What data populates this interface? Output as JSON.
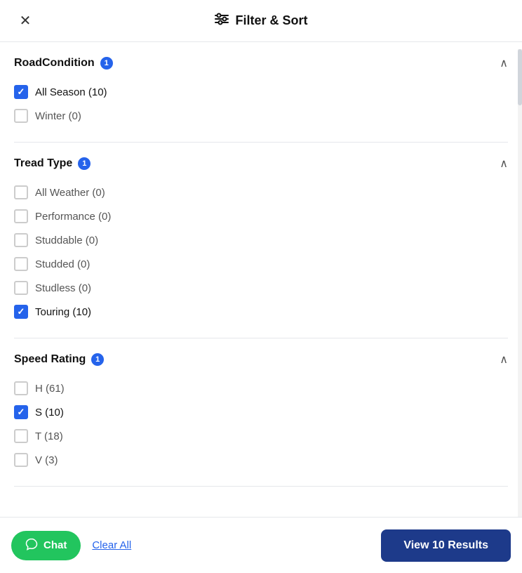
{
  "header": {
    "title": "Filter & Sort",
    "close_label": "×"
  },
  "sections": [
    {
      "id": "road-condition",
      "title": "RoadCondition",
      "info": "1",
      "expanded": true,
      "items": [
        {
          "id": "all-season",
          "label": "All Season",
          "count": 10,
          "checked": true
        },
        {
          "id": "winter",
          "label": "Winter",
          "count": 0,
          "checked": false
        }
      ]
    },
    {
      "id": "tread-type",
      "title": "Tread Type",
      "info": "1",
      "expanded": true,
      "items": [
        {
          "id": "all-weather",
          "label": "All Weather",
          "count": 0,
          "checked": false
        },
        {
          "id": "performance",
          "label": "Performance",
          "count": 0,
          "checked": false
        },
        {
          "id": "studdable",
          "label": "Studdable",
          "count": 0,
          "checked": false
        },
        {
          "id": "studded",
          "label": "Studded",
          "count": 0,
          "checked": false
        },
        {
          "id": "studless",
          "label": "Studless",
          "count": 0,
          "checked": false
        },
        {
          "id": "touring",
          "label": "Touring",
          "count": 10,
          "checked": true
        }
      ]
    },
    {
      "id": "speed-rating",
      "title": "Speed Rating",
      "info": "1",
      "expanded": true,
      "items": [
        {
          "id": "h",
          "label": "H",
          "count": 61,
          "checked": false
        },
        {
          "id": "s",
          "label": "S",
          "count": 10,
          "checked": true
        },
        {
          "id": "t",
          "label": "T",
          "count": 18,
          "checked": false
        },
        {
          "id": "v",
          "label": "V",
          "count": 3,
          "checked": false
        }
      ]
    }
  ],
  "footer": {
    "chat_label": "Chat",
    "clear_all_label": "Clear All",
    "view_results_label": "View 10 Results"
  }
}
